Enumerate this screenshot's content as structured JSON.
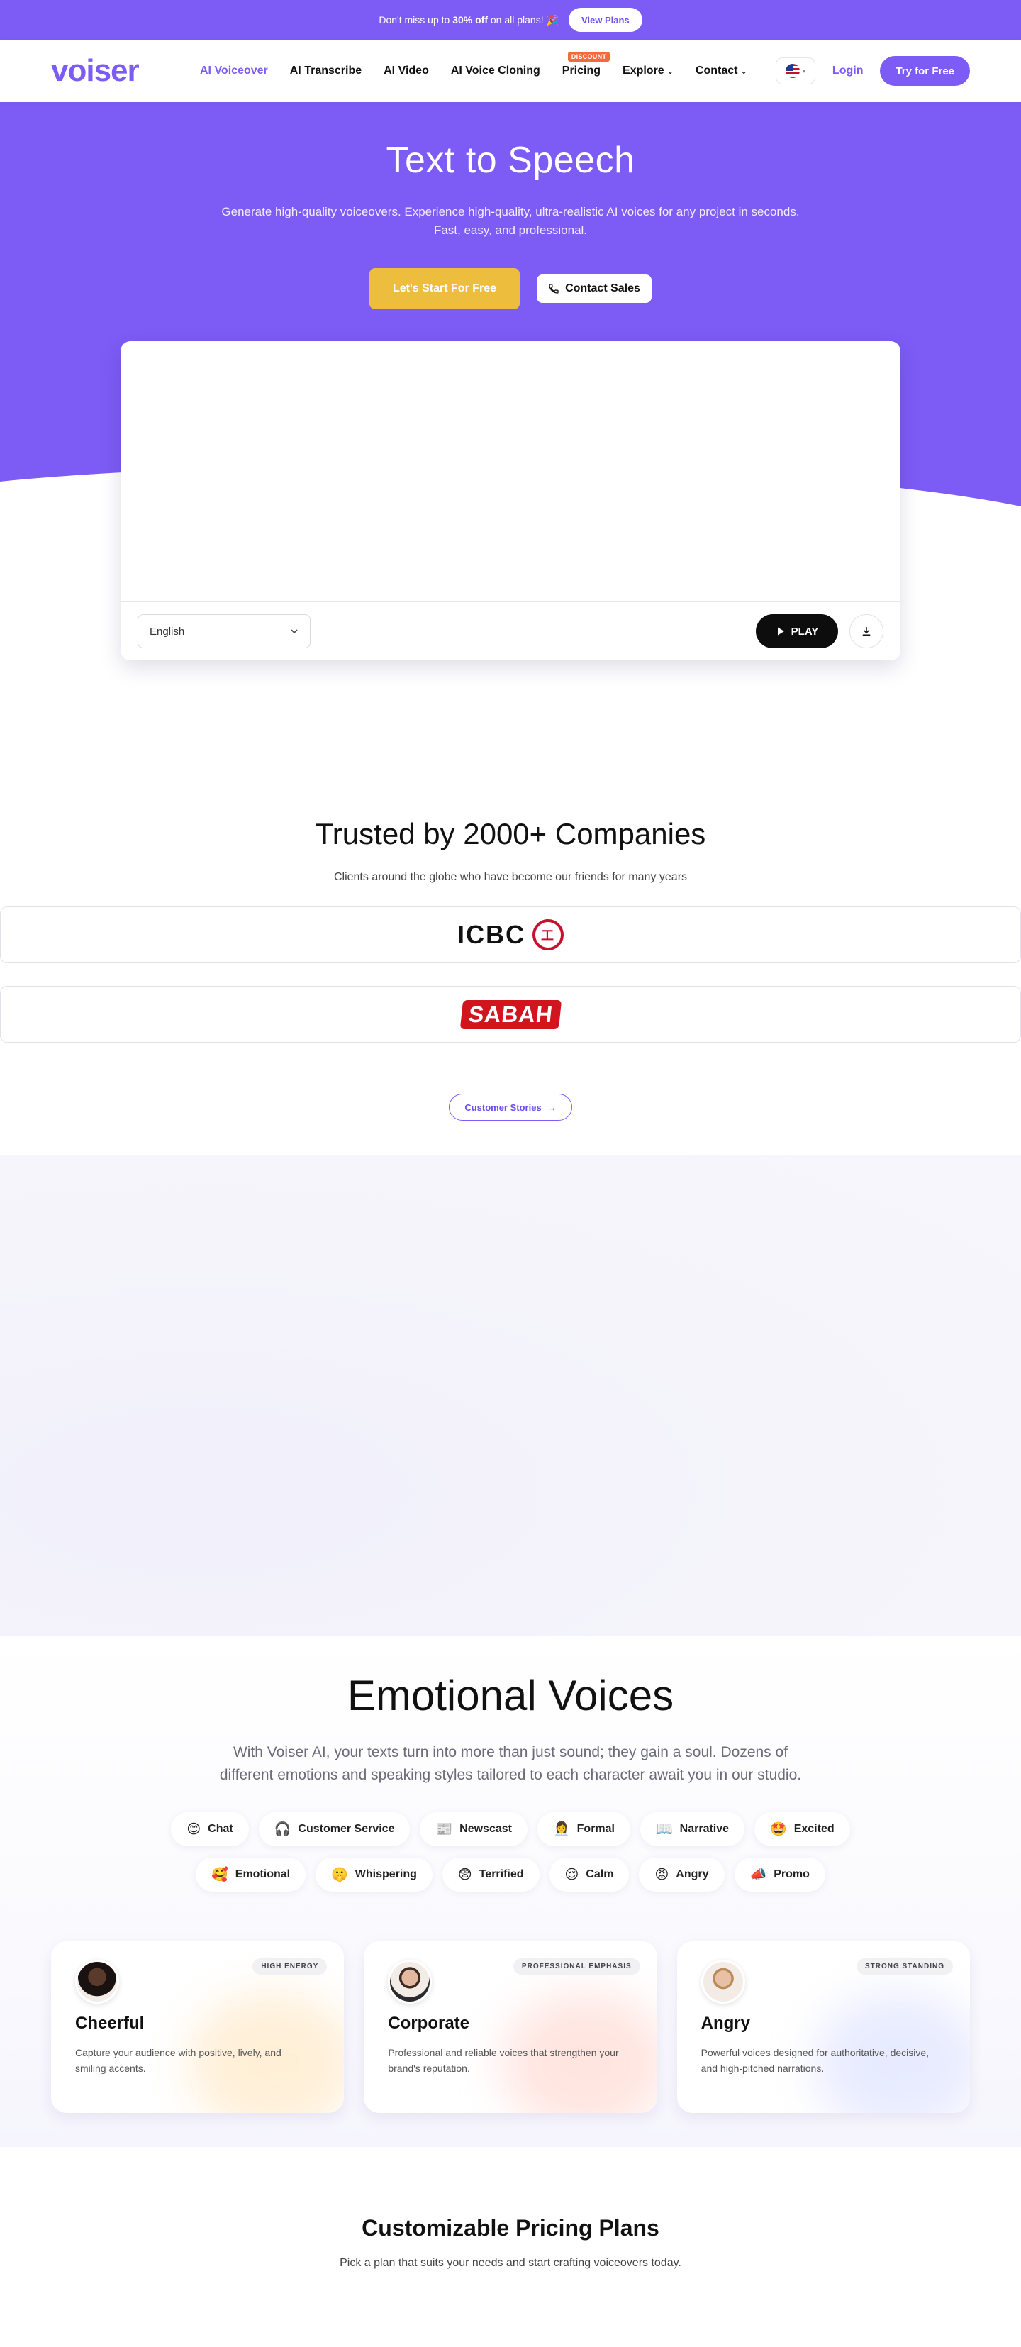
{
  "promo": {
    "text_pre": "Don't miss up to ",
    "text_bold": "30% off",
    "text_post": " on all plans! 🎉",
    "button": "View Plans"
  },
  "nav": {
    "logo": "voiser",
    "items": [
      {
        "label": "AI Voiceover",
        "active": true
      },
      {
        "label": "AI Transcribe"
      },
      {
        "label": "AI Video"
      },
      {
        "label": "AI Voice Cloning"
      }
    ],
    "pricing_label": "Pricing",
    "pricing_badge": "DISCOUNT",
    "explore_label": "Explore",
    "contact_label": "Contact",
    "login": "Login",
    "try_free": "Try for Free"
  },
  "hero": {
    "title": "Text to Speech",
    "subtitle_line1": "Generate high-quality voiceovers. Experience high-quality, ultra-realistic AI voices for any project in seconds.",
    "subtitle_line2": "Fast, easy, and professional.",
    "start_button": "Let's Start For Free",
    "contact_button": "Contact Sales"
  },
  "editor": {
    "text_value": "",
    "language": "English",
    "play_label": "PLAY"
  },
  "trusted": {
    "title": "Trusted by 2000+ Companies",
    "subtitle": "Clients around the globe who have become our friends for many years",
    "logos": [
      "ICBC",
      "SABAH"
    ],
    "stories_button": "Customer Stories"
  },
  "emotional": {
    "title": "Emotional Voices",
    "subtitle": "With Voiser AI, your texts turn into more than just sound; they gain a soul. Dozens of different emotions and speaking styles tailored to each character await you in our studio.",
    "chips": [
      {
        "emoji": "😊",
        "label": "Chat"
      },
      {
        "emoji": "🎧",
        "label": "Customer Service"
      },
      {
        "emoji": "📰",
        "label": "Newscast"
      },
      {
        "emoji": "👩‍💼",
        "label": "Formal"
      },
      {
        "emoji": "📖",
        "label": "Narrative"
      },
      {
        "emoji": "🤩",
        "label": "Excited"
      },
      {
        "emoji": "🥰",
        "label": "Emotional"
      },
      {
        "emoji": "🤫",
        "label": "Whispering"
      },
      {
        "emoji": "😨",
        "label": "Terrified"
      },
      {
        "emoji": "😌",
        "label": "Calm"
      },
      {
        "emoji": "😡",
        "label": "Angry"
      },
      {
        "emoji": "📣",
        "label": "Promo"
      }
    ],
    "cards": [
      {
        "tag": "HIGH ENERGY",
        "title": "Cheerful",
        "desc": "Capture your audience with positive, lively, and smiling accents.",
        "glow": "#ffe3b8"
      },
      {
        "tag": "PROFESSIONAL EMPHASIS",
        "title": "Corporate",
        "desc": "Professional and reliable voices that strengthen your brand's reputation.",
        "glow": "#ffd1c8"
      },
      {
        "tag": "STRONG STANDING",
        "title": "Angry",
        "desc": "Powerful voices designed for authoritative, decisive, and high-pitched narrations.",
        "glow": "#d6dcff"
      }
    ]
  },
  "pricing": {
    "title": "Customizable Pricing Plans",
    "subtitle": "Pick a plan that suits your needs and start crafting voiceovers today."
  },
  "colors": {
    "brand": "#7c5cf5",
    "accent_yellow": "#edbd3d",
    "discount": "#f46a3c"
  }
}
